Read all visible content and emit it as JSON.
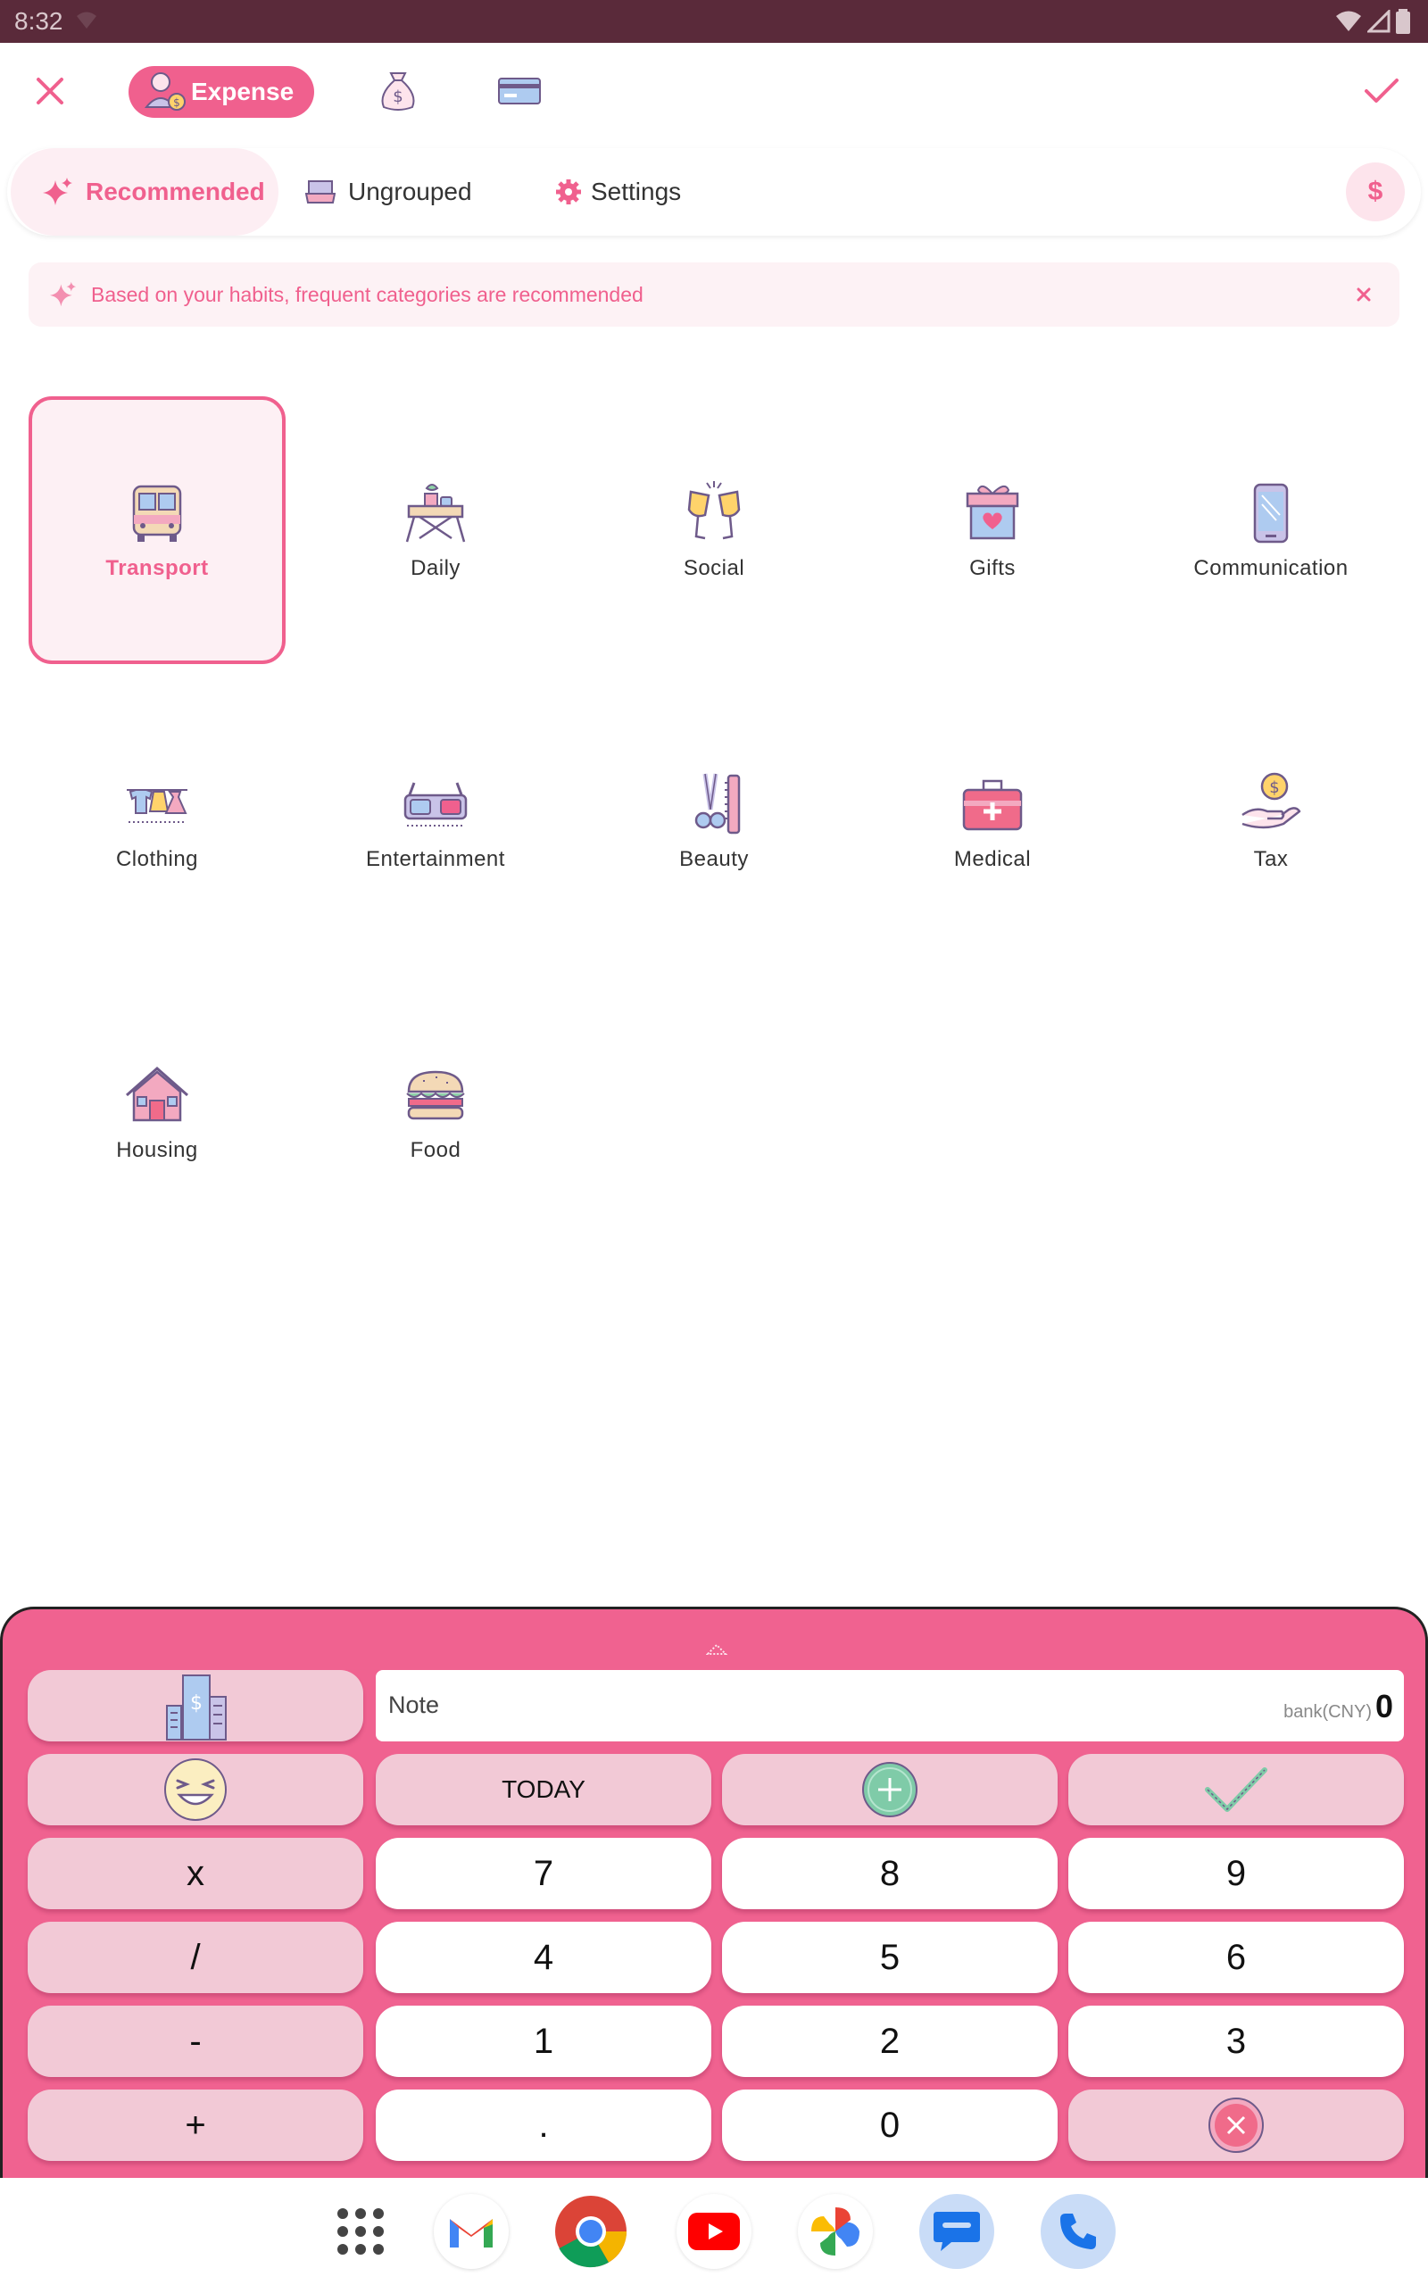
{
  "status_bar": {
    "time": "8:32"
  },
  "top_bar": {
    "type_chip_label": "Expense",
    "type_tabs": [
      "expense-icon",
      "income-icon",
      "transfer-icon"
    ]
  },
  "tabs": {
    "recommended": "Recommended",
    "ungrouped": "Ungrouped",
    "settings": "Settings",
    "currency_symbol": "$"
  },
  "hint": {
    "text": "Based on your habits, frequent categories are recommended"
  },
  "categories": [
    {
      "label": "Transport",
      "icon": "bus-icon",
      "selected": true
    },
    {
      "label": "Daily",
      "icon": "daily-table-icon",
      "selected": false
    },
    {
      "label": "Social",
      "icon": "cheers-icon",
      "selected": false
    },
    {
      "label": "Gifts",
      "icon": "gift-icon",
      "selected": false
    },
    {
      "label": "Communication",
      "icon": "phone-icon",
      "selected": false
    },
    {
      "label": "Clothing",
      "icon": "clothes-line-icon",
      "selected": false
    },
    {
      "label": "Entertainment",
      "icon": "3d-glasses-icon",
      "selected": false
    },
    {
      "label": "Beauty",
      "icon": "scissors-comb-icon",
      "selected": false
    },
    {
      "label": "Medical",
      "icon": "medical-kit-icon",
      "selected": false
    },
    {
      "label": "Tax",
      "icon": "coin-hand-icon",
      "selected": false
    },
    {
      "label": "Housing",
      "icon": "house-icon",
      "selected": false
    },
    {
      "label": "Food",
      "icon": "burger-icon",
      "selected": false
    }
  ],
  "keypad": {
    "note_label": "Note",
    "account": "bank(CNY)",
    "amount": "0",
    "today": "TODAY",
    "multiply": "x",
    "divide": "/",
    "minus": "-",
    "plus": "+",
    "digits": {
      "d7": "7",
      "d8": "8",
      "d9": "9",
      "d4": "4",
      "d5": "5",
      "d6": "6",
      "d1": "1",
      "d2": "2",
      "d3": "3",
      "dot": ".",
      "d0": "0"
    }
  },
  "colors": {
    "accent": "#f0608e",
    "keypad_bg": "#f06290",
    "op_key": "#f2c9d6",
    "status_bar": "#5a2a3a"
  },
  "dock": [
    "apps-grid-icon",
    "gmail-icon",
    "chrome-icon",
    "youtube-icon",
    "photos-icon",
    "messages-icon",
    "phone-dialer-icon"
  ]
}
